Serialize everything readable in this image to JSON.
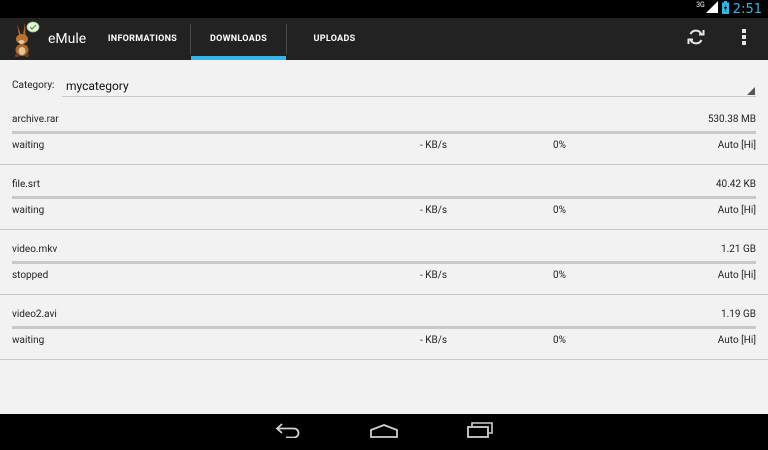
{
  "status_bar": {
    "network_type": "3G",
    "time": "2:51"
  },
  "action_bar": {
    "app_title": "eMule",
    "tabs": [
      {
        "label": "INFORMATIONS",
        "active": false
      },
      {
        "label": "DOWNLOADS",
        "active": true
      },
      {
        "label": "UPLOADS",
        "active": false
      }
    ],
    "actions": [
      "refresh-icon",
      "overflow-menu-icon"
    ]
  },
  "category": {
    "label": "Category:",
    "selected": "mycategory"
  },
  "downloads": [
    {
      "name": "archive.rar",
      "size": "530.38 MB",
      "status": "waiting",
      "speed": "- KB/s",
      "percent": "0%",
      "priority": "Auto [Hi]",
      "progress": 0
    },
    {
      "name": "file.srt",
      "size": "40.42 KB",
      "status": "waiting",
      "speed": "- KB/s",
      "percent": "0%",
      "priority": "Auto [Hi]",
      "progress": 0
    },
    {
      "name": "video.mkv",
      "size": "1.21 GB",
      "status": "stopped",
      "speed": "- KB/s",
      "percent": "0%",
      "priority": "Auto [Hi]",
      "progress": 0
    },
    {
      "name": "video2.avi",
      "size": "1.19 GB",
      "status": "waiting",
      "speed": "- KB/s",
      "percent": "0%",
      "priority": "Auto [Hi]",
      "progress": 0
    }
  ],
  "colors": {
    "accent": "#33b5e5",
    "action_bar": "#222222",
    "background": "#f2f2f2"
  }
}
